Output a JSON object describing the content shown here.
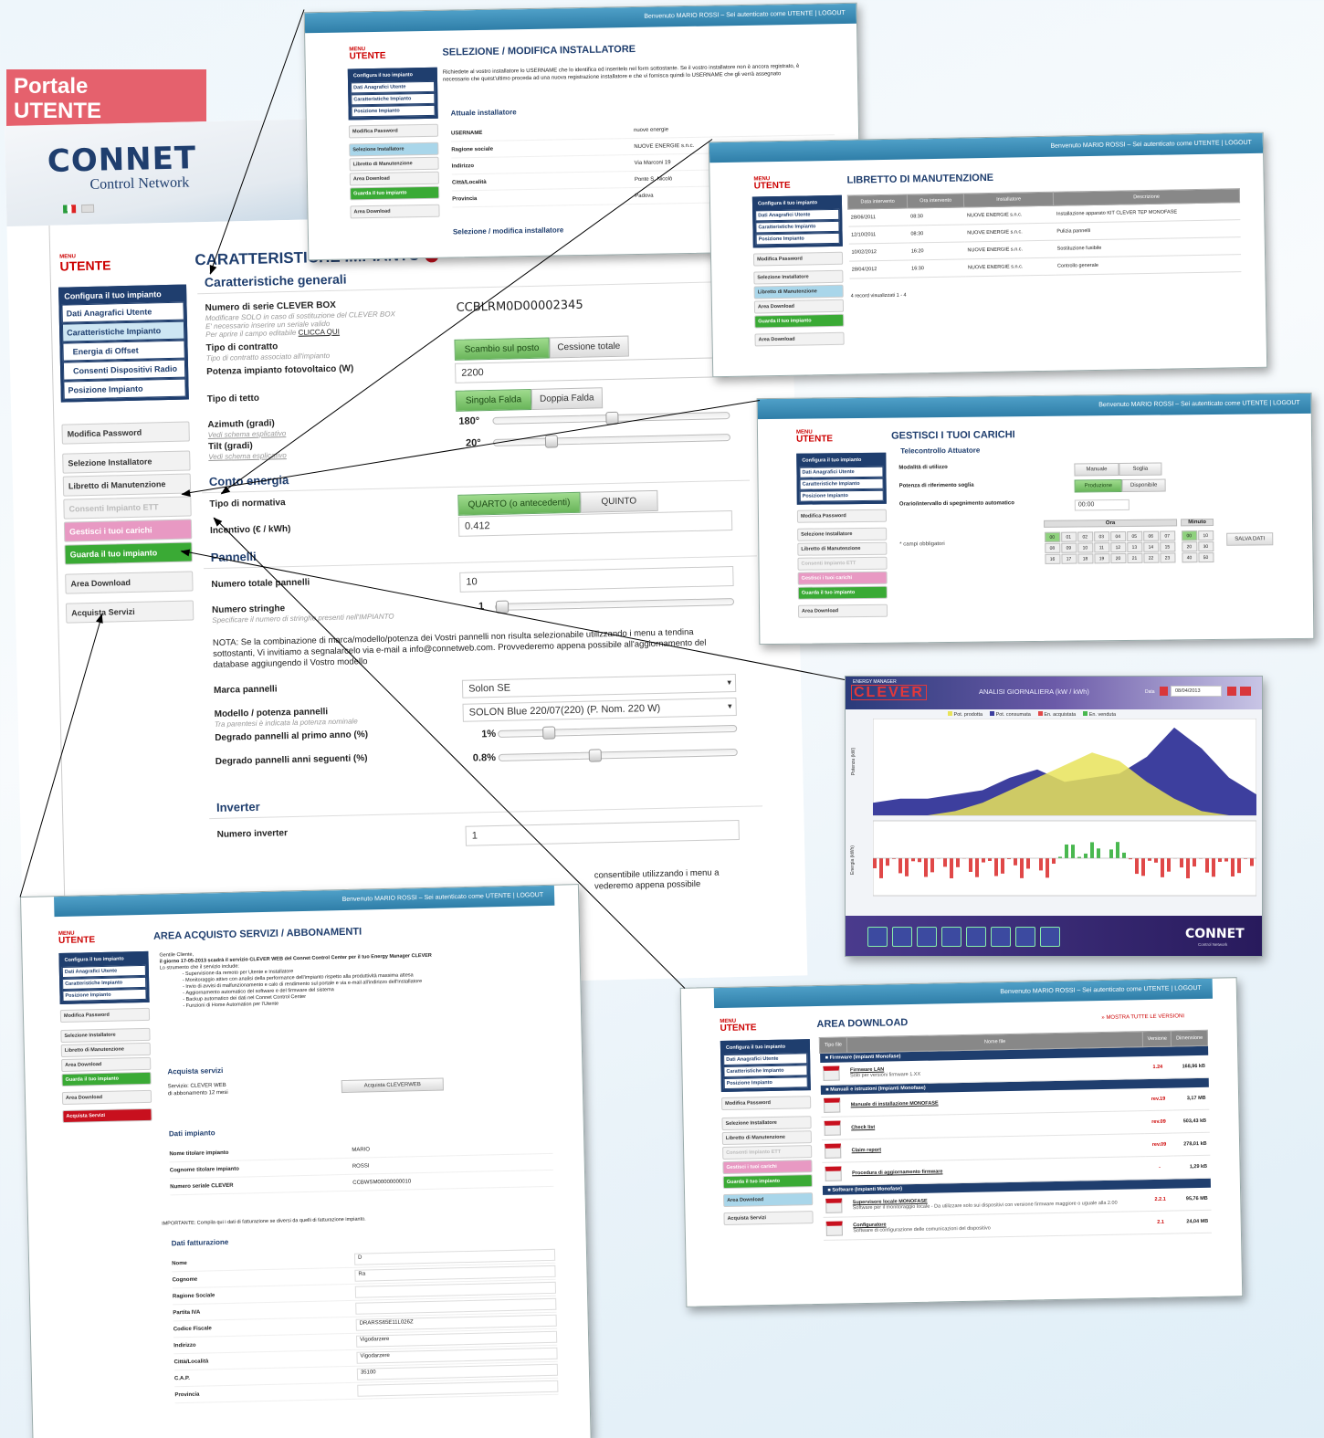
{
  "corner_tag": {
    "line1": "Portale",
    "line2": "UTENTE"
  },
  "brand": {
    "logo": "CONNET",
    "subtitle": "Control Network"
  },
  "top_user": "Benvenuto MARIO ROSSI – Sei autenticato come UTENTE | LOGOUT",
  "menu_label": {
    "small": "MENU",
    "big": "UTENTE"
  },
  "sidebar": {
    "group_title": "Configura il tuo impianto",
    "items": [
      "Dati Anagrafici Utente",
      "Caratteristiche Impianto",
      "Energia di Offset",
      "Consenti Dispositivi Radio",
      "Posizione Impianto"
    ],
    "standalone": [
      "Modifica Password",
      "Selezione Installatore",
      "Libretto di Manutenzione",
      "Consenti Impianto ETT",
      "Gestisci i tuoi carichi",
      "Guarda il tuo impianto",
      "Area Download",
      "Acquista Servizi"
    ]
  },
  "main": {
    "title": "CARATTERISTICHE IMPIANTO",
    "sec_general": "Caratteristiche generali",
    "serial_label": "Numero di serie CLEVER BOX",
    "serial_hint1": "Modificare SOLO in caso di sostituzione del CLEVER BOX",
    "serial_hint2": "E' necessario inserire un seriale valido",
    "serial_hint3": "Per aprire il campo editabile",
    "serial_link": "CLICCA QUI",
    "serial_value": "CCBLRM0D00002345",
    "contract_label": "Tipo di contratto",
    "contract_hint": "Tipo di contratto associato all'impianto",
    "contract_opt1": "Scambio sul posto",
    "contract_opt2": "Cessione totale",
    "power_label": "Potenza impianto fotovoltaico (W)",
    "power_value": "2200",
    "roof_label": "Tipo di tetto",
    "roof_opt1": "Singola Falda",
    "roof_opt2": "Doppia Falda",
    "azimuth_label": "Azimuth (gradi)",
    "azimuth_link": "Vedi schema esplicativo",
    "azimuth_value": "180°",
    "tilt_label": "Tilt (gradi)",
    "tilt_link": "Vedi schema esplicativo",
    "tilt_value": "20°",
    "sec_energy": "Conto energia",
    "norm_label": "Tipo di normativa",
    "norm_opt1": "QUARTO (o antecedenti)",
    "norm_opt2": "QUINTO",
    "incentive_label": "Incentivo (€ / kWh)",
    "incentive_value": "0.412",
    "sec_panels": "Pannelli",
    "panels_total_label": "Numero totale pannelli",
    "panels_total_value": "10",
    "strings_label": "Numero stringhe",
    "strings_hint": "Specificare il numero di stringhe presenti nell'IMPIANTO",
    "strings_value": "1",
    "note_text": "NOTA: Se la combinazione di marca/modello/potenza dei Vostri pannelli non risulta selezionabile utilizzando i menu a tendina sottostanti, Vi invitiamo a segnalarcelo via e-mail a info@connetweb.com. Provvederemo appena possibile all'aggiornamento del database aggiungendo il Vostro modello",
    "brand_label": "Marca pannelli",
    "brand_value": "Solon SE",
    "model_label": "Modello / potenza pannelli",
    "model_hint": "Tra parentesi è indicata la potenza nominale",
    "model_value": "SOLON Blue 220/07(220) (P. Nom. 220 W)",
    "degr1_label": "Degrado pannelli al primo anno (%)",
    "degr1_value": "1%",
    "degr2_label": "Degrado pannelli anni seguenti (%)",
    "degr2_value": "0.8%",
    "sec_inverter": "Inverter",
    "inverter_label": "Numero inverter",
    "inverter_value": "1",
    "bottom_text1": "consentibile utilizzando i menu a",
    "bottom_text2": "vederemo appena possibile"
  },
  "win_installer": {
    "title": "SELEZIONE / MODIFICA INSTALLATORE",
    "intro": "Richiedete al vostro installatore lo USERNAME che lo identifica ed inseritelo nel form sottostante. Se il vostro installatore non è ancora registrato, è necessario che quest'ultimo proceda ad una nuova registrazione installatore e che vi fornisca quindi lo USERNAME che gli verrà assegnato",
    "sec": "Attuale installatore",
    "fields": [
      [
        "USERNAME",
        "nuove energie"
      ],
      [
        "Ragione sociale",
        "NUOVE ENERGIE s.n.c."
      ],
      [
        "Indirizzo",
        "Via Marconi 19"
      ],
      [
        "Città/Località",
        "Ponte S. Nicolò"
      ],
      [
        "Provincia",
        "Padova"
      ]
    ],
    "sec2": "Selezione / modifica installatore"
  },
  "win_libretto": {
    "title": "LIBRETTO DI MANUTENZIONE",
    "cols": [
      "Data intervento",
      "Ora intervento",
      "Installatore",
      "Descrizione"
    ],
    "rows": [
      [
        "28/06/2011",
        "08:30",
        "NUOVE ENERGIE s.n.c.",
        "Installazione apparato KIT CLEVER TEP MONOFASE"
      ],
      [
        "12/10/2011",
        "08:30",
        "NUOVE ENERGIE s.n.c.",
        "Pulizia pannelli"
      ],
      [
        "10/02/2012",
        "16:20",
        "NUOVE ENERGIE s.n.c.",
        "Sostituzione fusibile"
      ],
      [
        "28/04/2012",
        "16:30",
        "NUOVE ENERGIE s.n.c.",
        "Controllo generale"
      ]
    ],
    "footer": "4 record visualizzati 1 - 4"
  },
  "win_carichi": {
    "title": "GESTISCI I TUOI CARICHI",
    "sub": "Telecontrollo Attuatore",
    "mode_label": "Modalità di utilizzo",
    "mode_opt1": "Manuale",
    "mode_opt2": "Soglia",
    "power_label": "Potenza di riferimento soglia",
    "power_opt1": "Produzione",
    "power_opt2": "Disponibile",
    "schedule_label": "Orario/intervallo di spegnimento automatico",
    "schedule_value": "00:00",
    "required": "* campi obbligatori",
    "hours_head": "Ora",
    "minutes_head": "Minuto",
    "hours": [
      "00",
      "01",
      "02",
      "03",
      "04",
      "05",
      "06",
      "07",
      "08",
      "09",
      "10",
      "11",
      "12",
      "13",
      "14",
      "15",
      "16",
      "17",
      "18",
      "19",
      "20",
      "21",
      "22",
      "23"
    ],
    "minutes": [
      "00",
      "10",
      "20",
      "30",
      "40",
      "50"
    ],
    "save": "SALVA DATI"
  },
  "win_chart": {
    "brand_small": "ENERGY MANAGER",
    "brand": "CLEVER",
    "title": "ANALISI GIORNALIERA (kW / kWh)",
    "date_label": "Data",
    "date_value": "08/04/2013",
    "legend": [
      "Pot. prodotta",
      "Pot. consumata",
      "En. acquistata",
      "En. venduta"
    ],
    "ylabel_top": "Potenza (kW)",
    "ylabel_bottom": "Energia (kWh)",
    "logo": "CONNET",
    "logo_sub": "Control Network"
  },
  "chart_data": {
    "type": "area",
    "title": "ANALISI GIORNALIERA (kW / kWh)",
    "series": [
      {
        "name": "Pot. prodotta",
        "values": [
          0,
          0,
          0,
          0.1,
          0.3,
          0.6,
          0.9,
          1.2,
          1.5,
          1.3,
          0.8,
          0.4,
          0.1,
          0,
          0
        ]
      },
      {
        "name": "Pot. consumata",
        "values": [
          0.3,
          0.4,
          0.4,
          0.5,
          0.6,
          0.9,
          1.1,
          0.8,
          0.9,
          1.0,
          1.4,
          2.1,
          1.6,
          0.9,
          0.5
        ]
      }
    ]
  },
  "win_acquisto": {
    "title": "AREA ACQUISTO SERVIZI / ABBONAMENTI",
    "intro1": "Gentile Cliente,",
    "intro2": "il giorno 17-05-2013 scadrà il servizio CLEVER WEB del Connet Control Center per il tuo Energy Manager CLEVER",
    "intro3": "Lo strumento che il servizio include:",
    "bullets": [
      "Supervisione da remoto per Utente e Installatore",
      "Monitoraggio attivo con analisi della performance dell'impianto rispetto alla produttività massima attesa",
      "Invio di avvisi di malfunzionamento e calo di rendimento sul portale e via e-mail all'indirizzo dell'Installatore",
      "Aggiornamento automatico del software e del firmware del sistema",
      "Backup automatico dei dati nel Connet Control Center",
      "Funzioni di Home Automation per l'Utente"
    ],
    "sec1": "Acquista servizi",
    "service_label": "Servizio: CLEVER WEB",
    "service_sub": "di abbonamento 12 mesi",
    "buy_btn": "Acquista CLEVERWEB",
    "sec2": "Dati impianto",
    "imp_fields": [
      [
        "Nome titolare impianto",
        "MARIO"
      ],
      [
        "Cognome titolare impianto",
        "ROSSI"
      ],
      [
        "Numero seriale CLEVER",
        "CCBWSM00000000010"
      ]
    ],
    "important": "IMPORTANTE: Compila qui i dati di fatturazione se diversi da quelli di fatturazione impianto.",
    "sec3": "Dati fatturazione",
    "fatt_fields": [
      [
        "Nome",
        "D"
      ],
      [
        "Cognome",
        "Ra"
      ],
      [
        "Ragione Sociale",
        ""
      ],
      [
        "Partita IVA",
        ""
      ],
      [
        "Codice Fiscale",
        "DRARSS65E11L026Z"
      ],
      [
        "Indirizzo",
        "Vigodarzere"
      ],
      [
        "Città/Località",
        "Vigodarzere"
      ],
      [
        "C.A.P.",
        "35100"
      ],
      [
        "Provincia",
        ""
      ]
    ]
  },
  "win_download": {
    "title": "AREA DOWNLOAD",
    "show_all": "» MOSTRA TUTTE LE VERSIONI",
    "cols": [
      "Tipo file",
      "Nome file",
      "Versione",
      "Dimensione"
    ],
    "groups": [
      {
        "name": "Firmware (Impianti Monofase)",
        "rows": [
          [
            "Firmware LAN",
            "Solo per versioni firmware 1.XX",
            "1.24",
            "168,96 kB"
          ]
        ]
      },
      {
        "name": "Manuali e istruzioni (Impianti Monofase)",
        "rows": [
          [
            "Manuale di installazione MONOFASE",
            "",
            "rev.19",
            "3,17 MB"
          ],
          [
            "Check list",
            "",
            "rev.09",
            "503,43 kB"
          ],
          [
            "Claim report",
            "",
            "rev.09",
            "278,01 kB"
          ],
          [
            "Procedura di aggiornamento firmware",
            "",
            "-",
            "1,29 kB"
          ]
        ]
      },
      {
        "name": "Software (Impianti Monofase)",
        "rows": [
          [
            "Supervisore locale MONOFASE",
            "Software per il monitoraggio locale - Da utilizzare solo sui dispositivi con versione firmware maggiore o uguale alla 2.00",
            "2.2.1",
            "95,76 MB"
          ],
          [
            "Configuratore",
            "Software di configurazione delle comunicazioni del dispositivo",
            "2.1",
            "24,04 MB"
          ]
        ]
      }
    ]
  }
}
